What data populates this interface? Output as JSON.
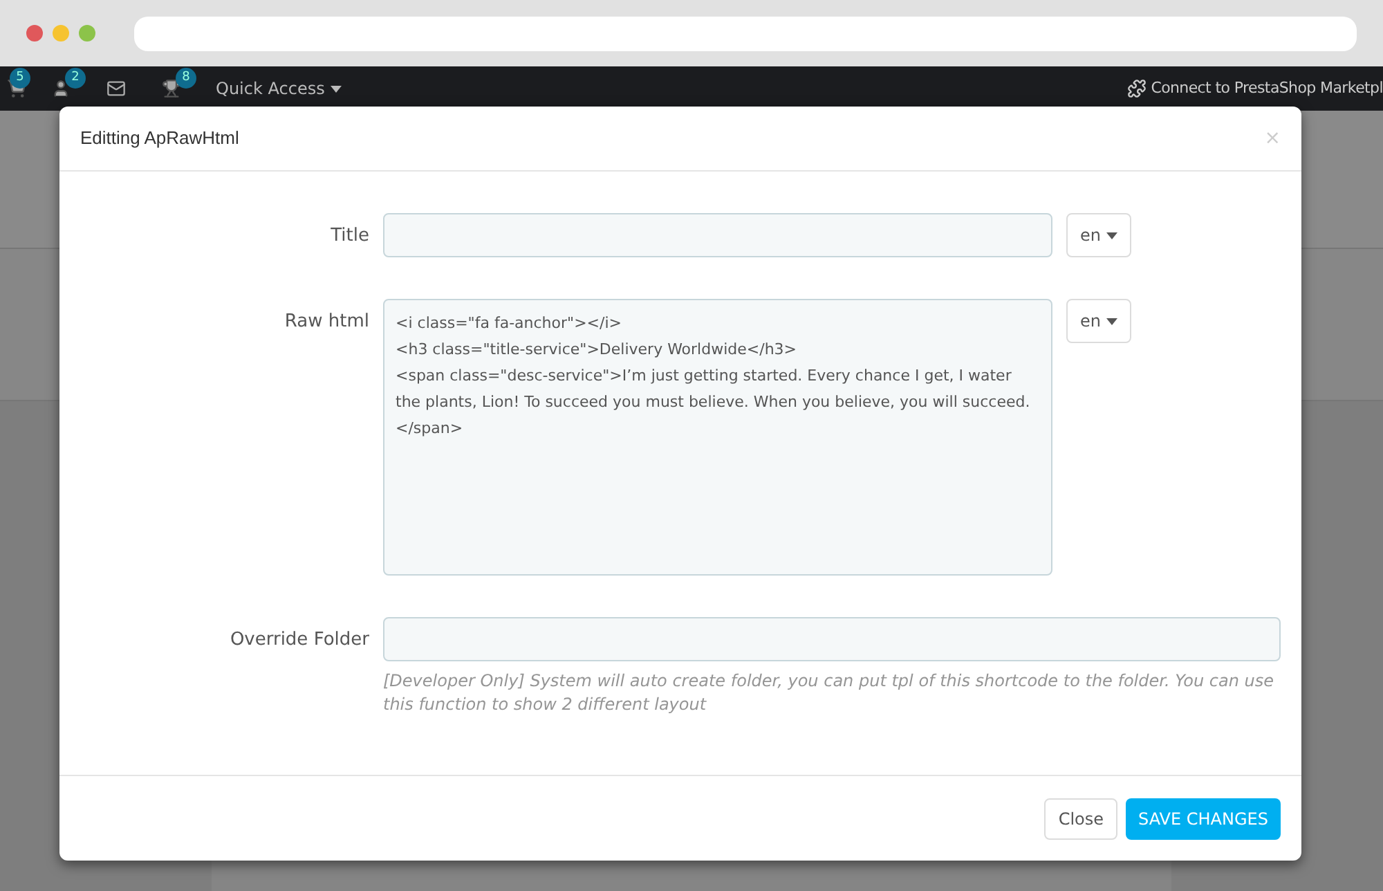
{
  "topbar": {
    "icons": [
      {
        "kind": "cart",
        "badge": "5"
      },
      {
        "kind": "user",
        "badge": "2"
      },
      {
        "kind": "mail"
      },
      {
        "kind": "trophy",
        "badge": "8"
      }
    ],
    "quick_access": "Quick Access",
    "connect": "Connect to PrestaShop Marketpl"
  },
  "modal": {
    "title": "Editting ApRawHtml",
    "close": "×",
    "fields": [
      {
        "kind": "input",
        "label": "Title",
        "lang": "en"
      },
      {
        "kind": "textarea",
        "label": "Raw html",
        "value": "<i class=\"fa fa-anchor\"></i>\n<h3 class=\"title-service\">Delivery Worldwide</h3>\n<span class=\"desc-service\">I’m just getting started. Every chance I get, I water the plants, Lion! To succeed you must believe. When you believe, you will succeed.\n</span>",
        "lang": "en"
      },
      {
        "kind": "wide",
        "label": "Override Folder",
        "help": "[Developer Only] System will auto create folder, you can put tpl of this shortcode to the folder. You can use this function to show 2 different layout"
      }
    ],
    "buttons": [
      {
        "kind": "default",
        "label": "Close"
      },
      {
        "kind": "primary",
        "label": "SAVE CHANGES"
      }
    ]
  }
}
